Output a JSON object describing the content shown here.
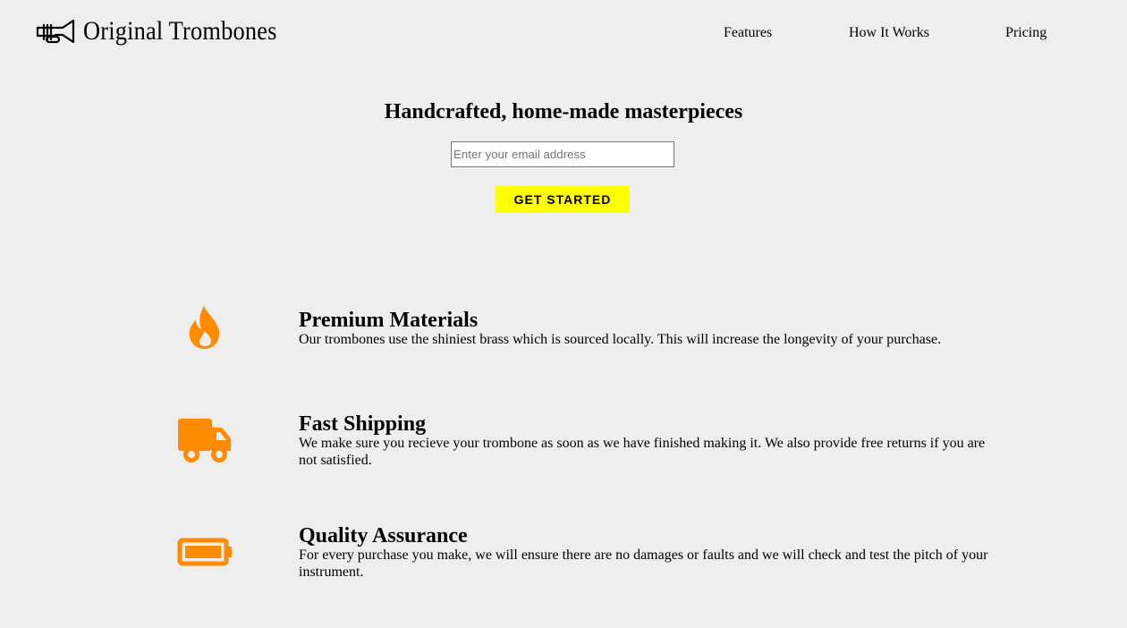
{
  "brand": {
    "name": "Original Trombones",
    "logo_icon": "trombone-icon"
  },
  "nav": {
    "items": [
      {
        "label": "Features"
      },
      {
        "label": "How It Works"
      },
      {
        "label": "Pricing"
      }
    ]
  },
  "hero": {
    "title": "Handcrafted, home-made masterpieces",
    "email_placeholder": "Enter your email address",
    "email_value": "",
    "cta_label": "GET STARTED"
  },
  "features": [
    {
      "icon": "fire-icon",
      "title": "Premium Materials",
      "description": "Our trombones use the shiniest brass which is sourced locally. This will increase the longevity of your purchase."
    },
    {
      "icon": "truck-icon",
      "title": "Fast Shipping",
      "description": "We make sure you recieve your trombone as soon as we have finished making it. We also provide free returns if you are not satisfied."
    },
    {
      "icon": "battery-icon",
      "title": "Quality Assurance",
      "description": "For every purchase you make, we will ensure there are no damages or faults and we will check and test the pitch of your instrument."
    }
  ],
  "colors": {
    "background": "#eeeeee",
    "accent_icon": "#ff8c00",
    "cta_background": "#ffff00"
  }
}
